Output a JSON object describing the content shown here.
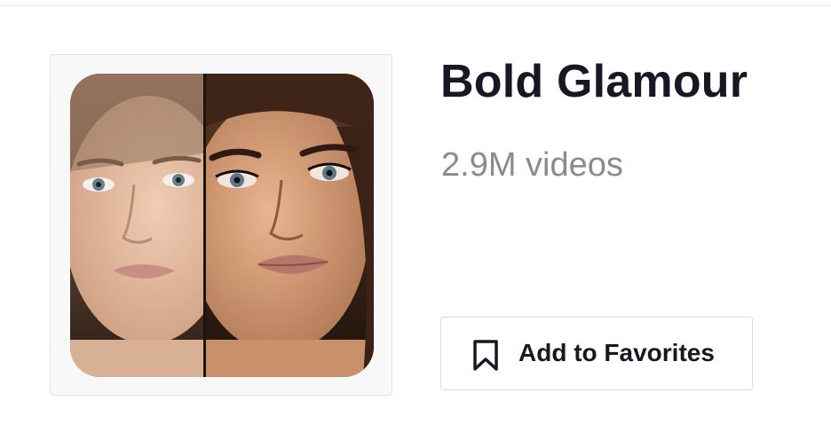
{
  "effect": {
    "title": "Bold Glamour",
    "video_count": "2.9M videos",
    "thumbnail_icon": "before-after-face-thumbnail"
  },
  "actions": {
    "favorite_label": "Add to Favorites",
    "favorite_icon": "bookmark-icon"
  },
  "colors": {
    "title": "#161823",
    "subtitle": "#8a8b91",
    "border": "#dcdce0"
  }
}
